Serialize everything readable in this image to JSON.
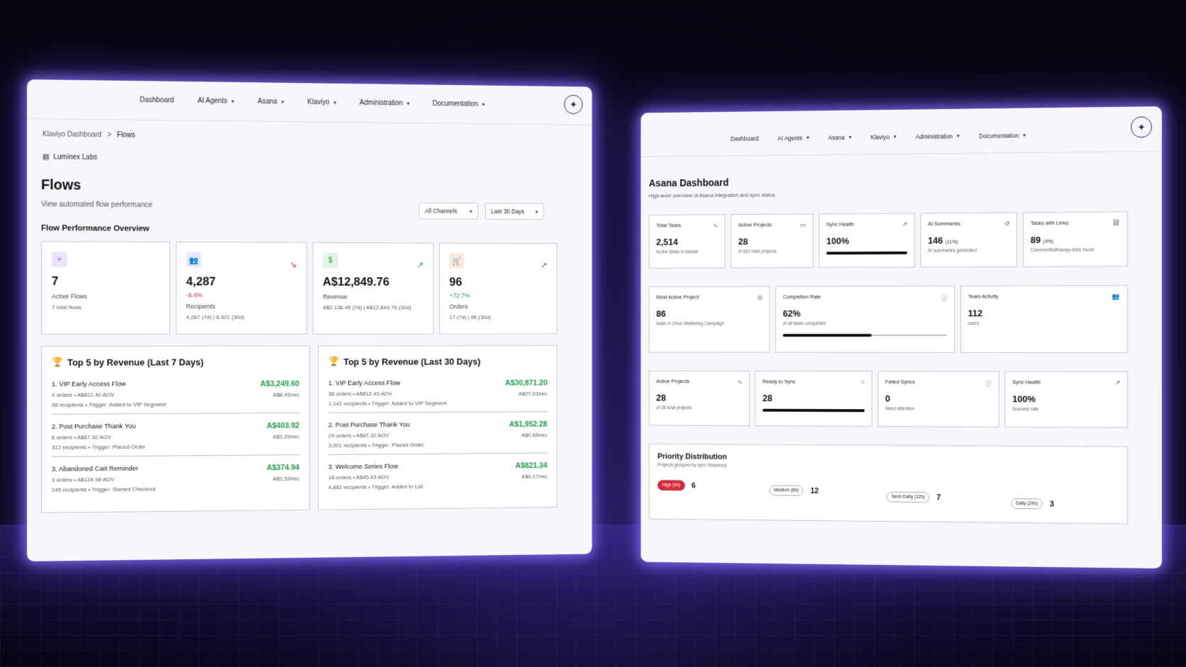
{
  "left": {
    "nav": [
      {
        "label": "Dashboard",
        "dropdown": false
      },
      {
        "label": "AI Agents",
        "dropdown": true
      },
      {
        "label": "Asana",
        "dropdown": true
      },
      {
        "label": "Klaviyo",
        "dropdown": true
      },
      {
        "label": "Administration",
        "dropdown": true
      },
      {
        "label": "Documentation",
        "dropdown": true
      }
    ],
    "breadcrumb": {
      "parent": "Klaviyo Dashboard",
      "sep": ">",
      "current": "Flows"
    },
    "org": "Luminex Labs",
    "title": "Flows",
    "subtitle": "View automated flow performance",
    "filters": {
      "channel": "All Channels",
      "range": "Last 30 Days"
    },
    "section": "Flow Performance Overview",
    "kpis": [
      {
        "value": "7",
        "delta": "",
        "label": "Active Flows",
        "sub": "7 total flows",
        "icon": "flow-icon",
        "icon_color": "#7c3aed",
        "icon_bg": "#ede4fb",
        "trend": ""
      },
      {
        "value": "4,287",
        "delta": "-8.4%",
        "label": "Recipients",
        "sub": "4,287 (7d) | 8,921 (30d)",
        "icon": "users-icon",
        "icon_color": "#3b5bdb",
        "icon_bg": "#e4e9fb",
        "trend": "down"
      },
      {
        "value": "A$12,849.76",
        "delta": "",
        "label": "Revenue",
        "sub": "A$2,136.45 (7d) | A$12,849.76 (30d)",
        "icon": "dollar-icon",
        "icon_color": "#1e9e4a",
        "icon_bg": "#e0f4e8",
        "trend": "up"
      },
      {
        "value": "96",
        "delta": "+72.7%",
        "label": "Orders",
        "sub": "17 (7d) | 96 (30d)",
        "icon": "cart-icon",
        "icon_color": "#e8590c",
        "icon_bg": "#fde9dc",
        "trend": "up"
      }
    ],
    "top5_7d": {
      "title": "Top 5 by Revenue (Last 7 Days)",
      "rows": [
        {
          "name": "1. VIP Early Access Flow",
          "meta1": "4 orders • A$812.40 AOV",
          "meta2": "96 recipients • Trigger: Added to VIP Segment",
          "amount": "A$3,249.60",
          "per": "A$8.45/rec"
        },
        {
          "name": "2. Post Purchase Thank You",
          "meta1": "6 orders • A$67.32 AOV",
          "meta2": "312 recipients • Trigger: Placed Order",
          "amount": "A$403.92",
          "per": "A$1.29/rec"
        },
        {
          "name": "3. Abandoned Cart Reminder",
          "meta1": "3 orders • A$124.98 AOV",
          "meta2": "245 recipients • Trigger: Started Checkout",
          "amount": "A$374.94",
          "per": "A$1.53/rec"
        }
      ]
    },
    "top5_30d": {
      "title": "Top 5 by Revenue (Last 30 Days)",
      "rows": [
        {
          "name": "1. VIP Early Access Flow",
          "meta1": "38 orders • A$812.40 AOV",
          "meta2": "1,142 recipients • Trigger: Added to VIP Segment",
          "amount": "A$30,871.20",
          "per": "A$27.03/rec"
        },
        {
          "name": "2. Post Purchase Thank You",
          "meta1": "29 orders • A$67.32 AOV",
          "meta2": "3,021 recipients • Trigger: Placed Order",
          "amount": "A$1,952.28",
          "per": "A$0.65/rec"
        },
        {
          "name": "3. Welcome Series Flow",
          "meta1": "18 orders • A$45.63 AOV",
          "meta2": "4,882 recipients • Trigger: Added to List",
          "amount": "A$821.34",
          "per": "A$0.17/rec"
        }
      ]
    }
  },
  "right": {
    "nav": [
      {
        "label": "Dashboard",
        "dropdown": false
      },
      {
        "label": "AI Agents",
        "dropdown": true
      },
      {
        "label": "Asana",
        "dropdown": true
      },
      {
        "label": "Klaviyo",
        "dropdown": true
      },
      {
        "label": "Administration",
        "dropdown": true
      },
      {
        "label": "Documentation",
        "dropdown": true
      }
    ],
    "title": "Asana Dashboard",
    "subtitle": "High-level overview of Asana integration and sync status",
    "row1": [
      {
        "title": "Total Tasks",
        "value": "2,514",
        "small": "",
        "sub": "Active tasks in tracker",
        "icon": "activity-icon",
        "progress": null
      },
      {
        "title": "Active Projects",
        "value": "28",
        "small": "",
        "sub": "of 631 total projects",
        "icon": "folder-icon",
        "progress": null
      },
      {
        "title": "Sync Health",
        "value": "100%",
        "small": "",
        "sub": "",
        "icon": "trend-up-icon",
        "progress": 1.0
      },
      {
        "title": "AI Summaries",
        "value": "146",
        "small": "(11%)",
        "sub": "AI summaries generated",
        "icon": "history-icon",
        "progress": null
      },
      {
        "title": "Tasks with Links",
        "value": "89",
        "small": "(4%)",
        "sub": "Commentful/Klaviyo links found",
        "icon": "link-icon",
        "progress": null
      }
    ],
    "row2": [
      {
        "title": "Most Active Project",
        "value": "86",
        "sub": "tasks in Orion Marketing Campaign",
        "icon": "target-icon",
        "progress": null
      },
      {
        "title": "Completion Rate",
        "value": "62%",
        "sub": "of all tasks completed",
        "icon": "info-icon",
        "progress": 0.54
      },
      {
        "title": "Team Activity",
        "value": "112",
        "sub": "users",
        "icon": "users-icon",
        "progress": null
      }
    ],
    "row3": [
      {
        "title": "Active Projects",
        "value": "28",
        "sub": "of 28 total projects",
        "icon": "activity-icon",
        "progress": null
      },
      {
        "title": "Ready to Sync",
        "value": "28",
        "sub": "",
        "icon": "circle-icon",
        "progress": 1.0
      },
      {
        "title": "Failed Syncs",
        "value": "0",
        "sub": "Need attention",
        "icon": "info-icon",
        "progress": null
      },
      {
        "title": "Sync Health",
        "value": "100%",
        "sub": "Success rate",
        "icon": "trend-up-icon",
        "progress": null
      }
    ],
    "priority": {
      "title": "Priority Distribution",
      "subtitle": "Projects grouped by sync frequency",
      "items": [
        {
          "label": "High (4h)",
          "count": "6"
        },
        {
          "label": "Medium (6h)",
          "count": "12"
        },
        {
          "label": "Semi-Daily (12h)",
          "count": "7"
        },
        {
          "label": "Daily (24h)",
          "count": "3"
        }
      ]
    }
  }
}
